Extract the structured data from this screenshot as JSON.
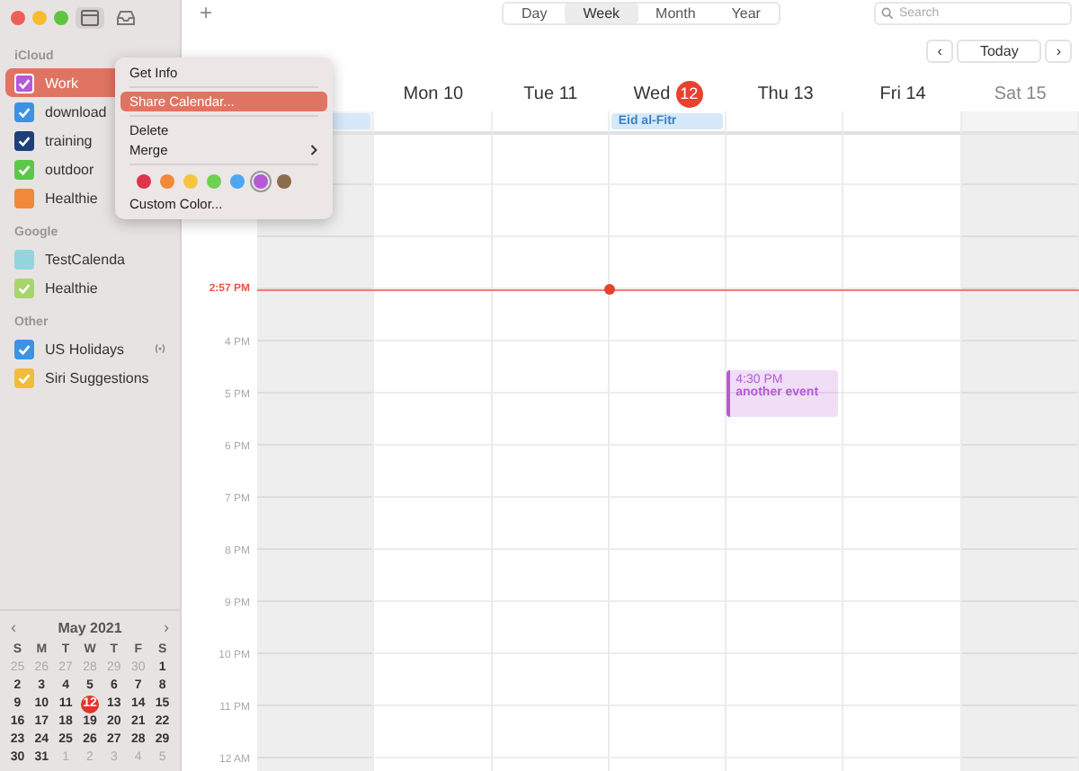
{
  "sidebar": {
    "groups": [
      {
        "title": "iCloud",
        "items": [
          {
            "name": "Work",
            "color": "#b45ad6",
            "checked": true,
            "selected": true,
            "shared": false
          },
          {
            "name": "download",
            "color": "#3b93e6",
            "checked": true,
            "selected": false,
            "shared": false
          },
          {
            "name": "training",
            "color": "#1d3f7a",
            "checked": true,
            "selected": false,
            "shared": false
          },
          {
            "name": "outdoor",
            "color": "#5cc84a",
            "checked": true,
            "selected": false,
            "shared": false
          },
          {
            "name": "Healthie",
            "color": "#f08a3a",
            "checked": false,
            "selected": false,
            "shared": false
          }
        ]
      },
      {
        "title": "Google",
        "items": [
          {
            "name": "TestCalenda",
            "color": "#93d5de",
            "checked": false,
            "selected": false,
            "shared": false
          },
          {
            "name": "Healthie",
            "color": "#a8d46c",
            "checked": true,
            "selected": false,
            "shared": false
          }
        ]
      },
      {
        "title": "Other",
        "items": [
          {
            "name": "US Holidays",
            "color": "#3b93e6",
            "checked": true,
            "selected": false,
            "shared": true
          },
          {
            "name": "Siri Suggestions",
            "color": "#f0bd3a",
            "checked": true,
            "selected": false,
            "shared": false
          }
        ]
      }
    ],
    "mini_calendar": {
      "title": "May 2021",
      "prev": "‹",
      "next": "›",
      "weekdays": [
        "S",
        "M",
        "T",
        "W",
        "T",
        "F",
        "S"
      ],
      "weeks": [
        [
          {
            "d": "25",
            "other_month": true,
            "today": false
          },
          {
            "d": "26",
            "other_month": true,
            "today": false
          },
          {
            "d": "27",
            "other_month": true,
            "today": false
          },
          {
            "d": "28",
            "other_month": true,
            "today": false
          },
          {
            "d": "29",
            "other_month": true,
            "today": false
          },
          {
            "d": "30",
            "other_month": true,
            "today": false
          },
          {
            "d": "1",
            "other_month": false,
            "today": false
          }
        ],
        [
          {
            "d": "2",
            "other_month": false,
            "today": false
          },
          {
            "d": "3",
            "other_month": false,
            "today": false
          },
          {
            "d": "4",
            "other_month": false,
            "today": false
          },
          {
            "d": "5",
            "other_month": false,
            "today": false
          },
          {
            "d": "6",
            "other_month": false,
            "today": false
          },
          {
            "d": "7",
            "other_month": false,
            "today": false
          },
          {
            "d": "8",
            "other_month": false,
            "today": false
          }
        ],
        [
          {
            "d": "9",
            "other_month": false,
            "today": false
          },
          {
            "d": "10",
            "other_month": false,
            "today": false
          },
          {
            "d": "11",
            "other_month": false,
            "today": false
          },
          {
            "d": "12",
            "other_month": false,
            "today": true
          },
          {
            "d": "13",
            "other_month": false,
            "today": false
          },
          {
            "d": "14",
            "other_month": false,
            "today": false
          },
          {
            "d": "15",
            "other_month": false,
            "today": false
          }
        ],
        [
          {
            "d": "16",
            "other_month": false,
            "today": false
          },
          {
            "d": "17",
            "other_month": false,
            "today": false
          },
          {
            "d": "18",
            "other_month": false,
            "today": false
          },
          {
            "d": "19",
            "other_month": false,
            "today": false
          },
          {
            "d": "20",
            "other_month": false,
            "today": false
          },
          {
            "d": "21",
            "other_month": false,
            "today": false
          },
          {
            "d": "22",
            "other_month": false,
            "today": false
          }
        ],
        [
          {
            "d": "23",
            "other_month": false,
            "today": false
          },
          {
            "d": "24",
            "other_month": false,
            "today": false
          },
          {
            "d": "25",
            "other_month": false,
            "today": false
          },
          {
            "d": "26",
            "other_month": false,
            "today": false
          },
          {
            "d": "27",
            "other_month": false,
            "today": false
          },
          {
            "d": "28",
            "other_month": false,
            "today": false
          },
          {
            "d": "29",
            "other_month": false,
            "today": false
          }
        ],
        [
          {
            "d": "30",
            "other_month": false,
            "today": false
          },
          {
            "d": "31",
            "other_month": false,
            "today": false
          },
          {
            "d": "1",
            "other_month": true,
            "today": false
          },
          {
            "d": "2",
            "other_month": true,
            "today": false
          },
          {
            "d": "3",
            "other_month": true,
            "today": false
          },
          {
            "d": "4",
            "other_month": true,
            "today": false
          },
          {
            "d": "5",
            "other_month": true,
            "today": false
          }
        ]
      ]
    }
  },
  "toolbar": {
    "add": "+",
    "views": [
      {
        "label": "Day",
        "selected": false
      },
      {
        "label": "Week",
        "selected": true
      },
      {
        "label": "Month",
        "selected": false
      },
      {
        "label": "Year",
        "selected": false
      }
    ],
    "search": {
      "placeholder": "Search"
    }
  },
  "nav": {
    "prev": "‹",
    "today": "Today",
    "next": "›"
  },
  "days": [
    {
      "today": false,
      "weekend": true,
      "all_day": [
        {
          "color": "#d6e8fa"
        }
      ]
    },
    {
      "name": "Mon",
      "number": "10",
      "today": false,
      "weekend": false
    },
    {
      "name": "Tue",
      "number": "11",
      "today": false,
      "weekend": false
    },
    {
      "name": "Wed",
      "number": "12",
      "today": true,
      "weekend": false,
      "all_day": [
        {
          "title": "Eid al-Fitr",
          "color": "#d6e8fa"
        }
      ]
    },
    {
      "name": "Thu",
      "number": "13",
      "today": false,
      "weekend": false,
      "events": [
        {
          "time": "4:30 PM",
          "title": "another event",
          "color": "#b45ad6"
        }
      ]
    },
    {
      "name": "Fri",
      "number": "14",
      "today": false,
      "weekend": false
    },
    {
      "name": "Sat",
      "number": "15",
      "today": false,
      "weekend": true
    }
  ],
  "hour_labels": [
    "4 PM",
    "5 PM",
    "6 PM",
    "7 PM",
    "8 PM",
    "9 PM",
    "10 PM",
    "11 PM",
    "12 AM"
  ],
  "current_time": "2:57 PM",
  "context_menu": {
    "items": [
      {
        "kind": "item",
        "label": "Get Info",
        "selected": false,
        "submenu": false
      },
      {
        "kind": "separator"
      },
      {
        "kind": "item",
        "label": "Share Calendar...",
        "selected": true,
        "submenu": false
      },
      {
        "kind": "separator"
      },
      {
        "kind": "item",
        "label": "Delete",
        "selected": false,
        "submenu": false
      },
      {
        "kind": "item",
        "label": "Merge",
        "selected": false,
        "submenu": true
      },
      {
        "kind": "separator"
      },
      {
        "kind": "colors",
        "colors": [
          {
            "color": "#e0344e",
            "selected": false
          },
          {
            "color": "#f08a3a",
            "selected": false
          },
          {
            "color": "#f5c542",
            "selected": false
          },
          {
            "color": "#6fd14f",
            "selected": false
          },
          {
            "color": "#4aa8f0",
            "selected": false
          },
          {
            "color": "#b45ad6",
            "selected": true
          },
          {
            "color": "#8a6d4a",
            "selected": false
          }
        ]
      },
      {
        "kind": "item",
        "label": "Custom Color...",
        "selected": false,
        "submenu": false
      }
    ]
  }
}
